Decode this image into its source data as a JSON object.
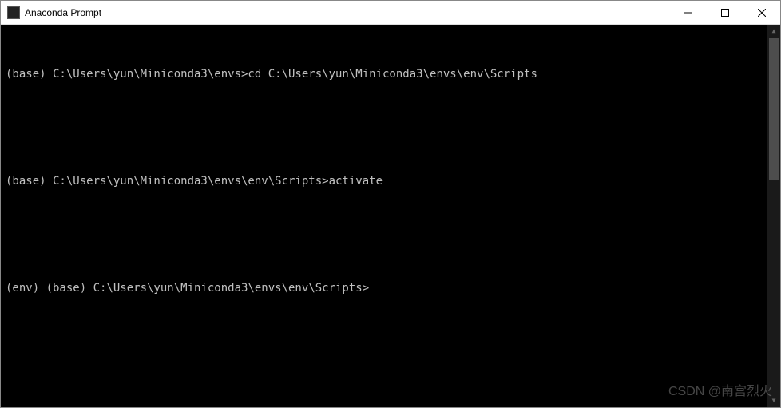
{
  "window": {
    "title": "Anaconda Prompt"
  },
  "terminal": {
    "lines": [
      "(base) C:\\Users\\yun\\Miniconda3\\envs>cd C:\\Users\\yun\\Miniconda3\\envs\\env\\Scripts",
      "",
      "(base) C:\\Users\\yun\\Miniconda3\\envs\\env\\Scripts>activate",
      "",
      "(env) (base) C:\\Users\\yun\\Miniconda3\\envs\\env\\Scripts>"
    ]
  },
  "watermark": "CSDN @南宫烈火"
}
